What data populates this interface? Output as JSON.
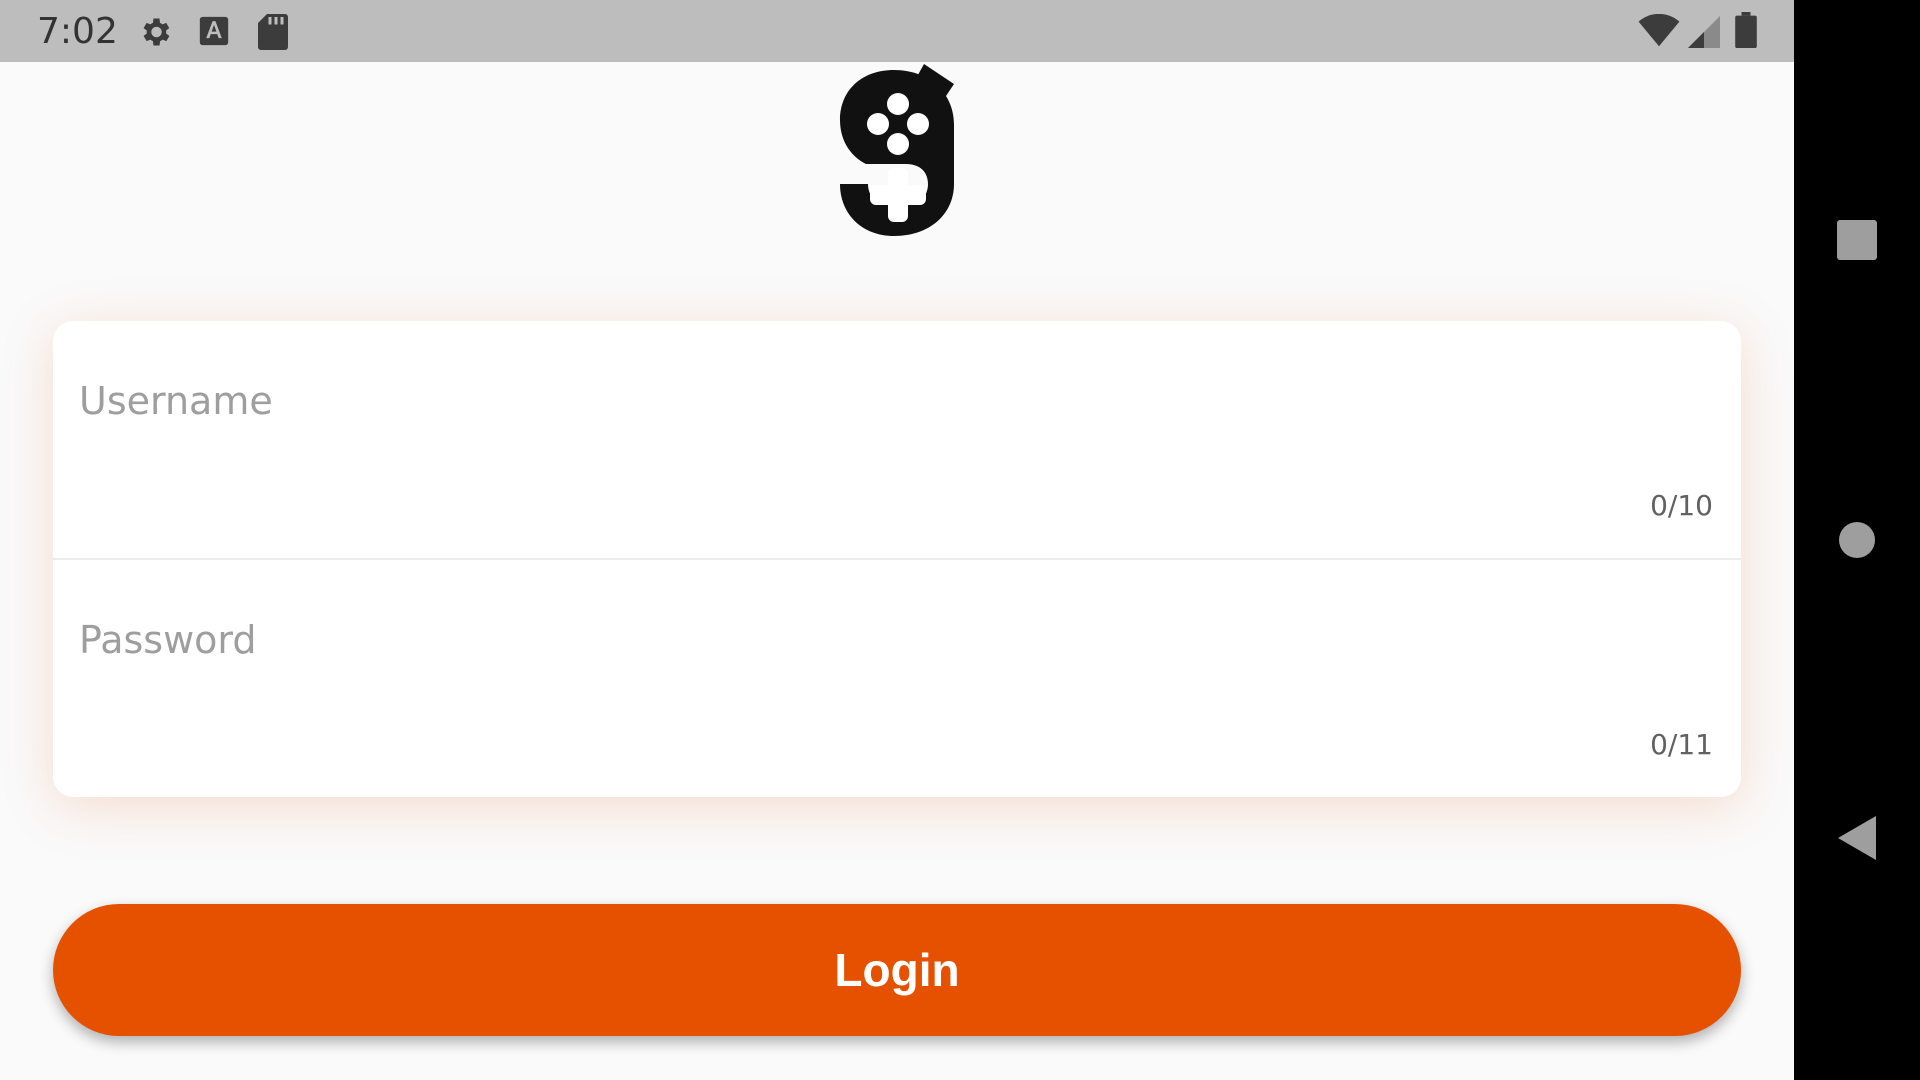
{
  "status_bar": {
    "time": "7:02",
    "icons": [
      "gear-icon",
      "font-a-icon",
      "sd-card-icon",
      "wifi-icon",
      "cell-signal-icon",
      "battery-icon"
    ]
  },
  "nav_bar": {
    "icons": [
      "recents-square-icon",
      "home-circle-icon",
      "back-triangle-icon"
    ]
  },
  "logo": {
    "icon": "gamepad-g-logo"
  },
  "form": {
    "username": {
      "placeholder": "Username",
      "value": "",
      "counter": "0/10"
    },
    "password": {
      "placeholder": "Password",
      "value": "",
      "counter": "0/11"
    }
  },
  "login_button": {
    "label": "Login"
  },
  "colors": {
    "accent": "#e65100",
    "status_bar": "#bdbdbd",
    "nav_bar": "#000000",
    "background": "#fafafa"
  }
}
